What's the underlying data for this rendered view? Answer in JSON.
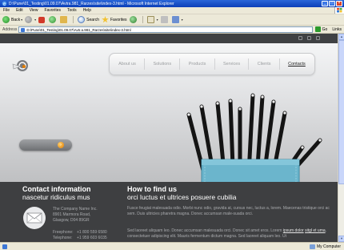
{
  "window": {
    "title": "D:\\Pune\\01_Testing\\01.09.07\\Avtra.981_Rarzes\\site\\index-3.html - Microsoft Internet Explorer",
    "buttons": [
      "_",
      "□",
      "×"
    ]
  },
  "menu": {
    "items": [
      "File",
      "Edit",
      "View",
      "Favorites",
      "Tools",
      "Help"
    ]
  },
  "toolbar": {
    "back_label": "Back",
    "search_label": "Search",
    "favorites_label": "Favorites"
  },
  "address": {
    "label": "Address",
    "value": "D:\\Pune\\01_Testing\\01.09.07\\Avtr.a.981_Rarzes\\site\\index-3.html",
    "go_label": "Go",
    "links_label": "Links"
  },
  "site": {
    "nav": [
      "About us",
      "Solutions",
      "Products",
      "Services",
      "Clients",
      "Contacts"
    ],
    "active_nav": "Contacts",
    "contact": {
      "title": "Contact information",
      "subtitle": "nascetur ridiculus mus",
      "address_lines": [
        "The Company Name Inc.",
        "8901 Marmora Road,",
        "Glasgow, D04 89GR"
      ],
      "phone_label": "Freephone:",
      "phone_value": "+1 800 559 6580",
      "tel_label": "Telephone:",
      "tel_value": "+1 959 603 6035"
    },
    "find": {
      "title": "How to find us",
      "subtitle": "orci luctus et ultrices posuere cubilia",
      "para1": "Fusce feugiat malesuada odio. Morbi nunc odio, gravida at, cursus nec, luctus a, lorem. Maecenas tristique orci ac sem. Duis ultricies pharetra magna. Donec accumsan male-suada orci.",
      "para2_a": "Sed laoreet aliquam leo. Donec accumsan malesuada orci. Donec sit amet eros. Lorem ",
      "para2_link1": "ipsum dolor",
      "para2_b": " ",
      "para2_link2": "sitgl et uma",
      "para2_c": ", consectetuer adipiscing elit. Mauris fermentum dictum magna. Sed laoreet aliquam leo. Ut"
    },
    "accent_color": "#f29400"
  },
  "status": {
    "zone": "My Computer"
  }
}
